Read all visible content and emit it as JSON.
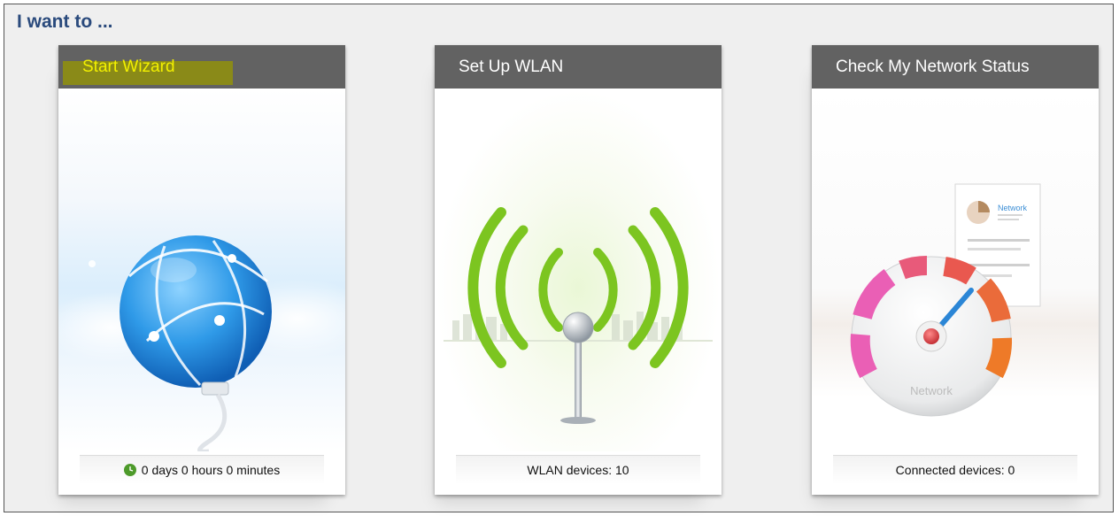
{
  "page": {
    "title": "I want to ..."
  },
  "cards": [
    {
      "title": "Start Wizard",
      "footer_text": "0 days 0 hours 0 minutes",
      "footer_icon": "clock-icon",
      "illustration": "globe-icon"
    },
    {
      "title": "Set Up WLAN",
      "footer_text": "WLAN devices: 10",
      "illustration": "wlan-antenna-icon"
    },
    {
      "title": "Check My Network Status",
      "footer_text": "Connected devices: 0",
      "illustration": "network-gauge-icon",
      "gauge_label": "Network",
      "report_label": "Network"
    }
  ],
  "colors": {
    "header_bg": "#626262",
    "title_accent": "#2a4a7c",
    "wizard_text": "#f2f000",
    "annotation_red": "#d9232a",
    "wifi_green": "#7cc520",
    "clock_green": "#4d9a2a"
  }
}
